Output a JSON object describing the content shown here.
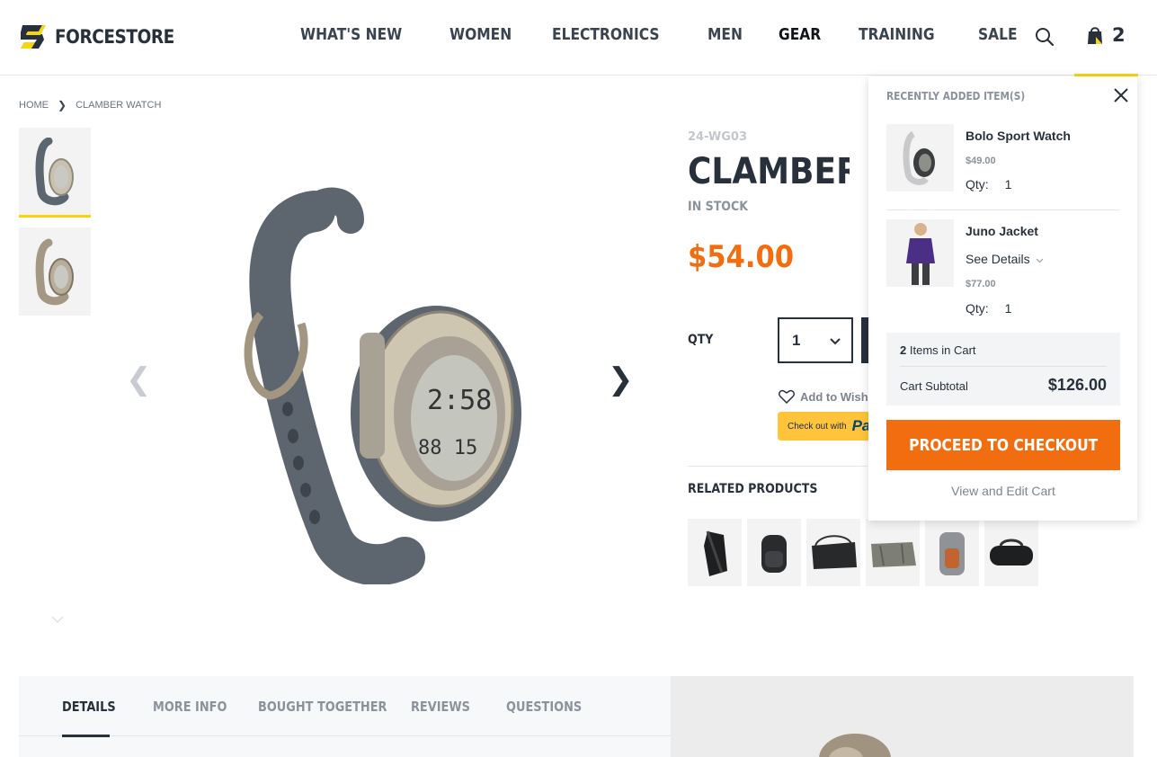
{
  "header": {
    "brand": "FORCESTORE",
    "nav": [
      "WHAT'S NEW",
      "WOMEN",
      "ELECTRONICS",
      "MEN",
      "GEAR",
      "TRAINING",
      "SALE"
    ],
    "active_nav": "GEAR",
    "cart_count": "2",
    "accent": "#f5d60e"
  },
  "breadcrumb": {
    "home": "HOME",
    "separator": "❯",
    "current": "CLAMBER WATCH"
  },
  "gallery": {
    "prev": "❮",
    "next": "❯"
  },
  "product": {
    "sku": "24-WG03",
    "title": "CLAMBER WATCH",
    "stock": "IN STOCK",
    "price": "$54.00",
    "price_color": "#f26d10",
    "qty_label": "QTY",
    "qty_value": "1",
    "wishlist_label": "Add to Wish List",
    "paypal_prefix": "Check out with",
    "paypal_brand": "PayPal",
    "related_title": "RELATED PRODUCTS"
  },
  "tabs": [
    "DETAILS",
    "MORE INFO",
    "BOUGHT TOGETHER",
    "REVIEWS",
    "QUESTIONS"
  ],
  "active_tab": "DETAILS",
  "minicart": {
    "heading": "RECENTLY ADDED ITEM(S)",
    "items": [
      {
        "name": "Bolo Sport Watch",
        "price": "$49.00",
        "qty_label": "Qty:",
        "qty": "1"
      },
      {
        "name": "Juno Jacket",
        "details_label": "See Details",
        "price": "$77.00",
        "qty_label": "Qty:",
        "qty": "1"
      }
    ],
    "count_number": "2",
    "count_text": "Items in Cart",
    "subtotal_label": "Cart Subtotal",
    "subtotal": "$126.00",
    "checkout_label": "PROCEED TO CHECKOUT",
    "view_cart_label": "View and Edit Cart"
  }
}
